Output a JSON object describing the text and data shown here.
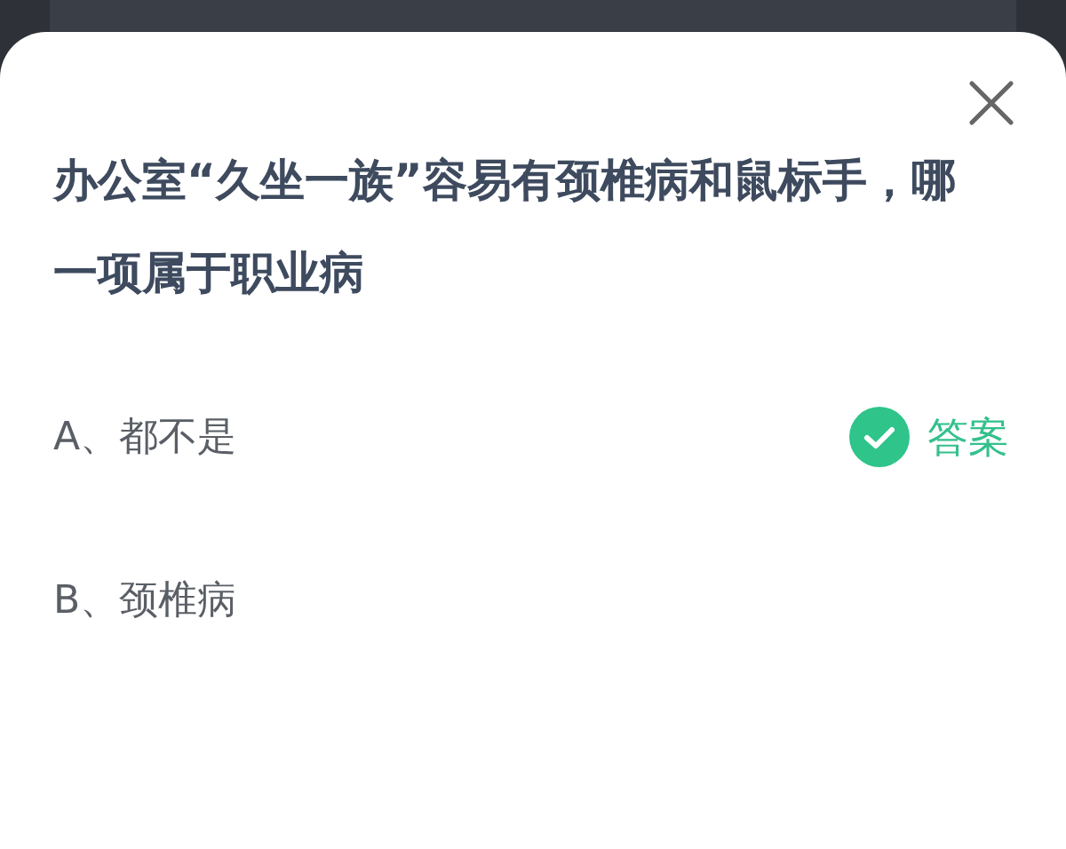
{
  "question": "办公室“久坐一族”容易有颈椎病和鼠标手，哪一项属于职业病",
  "options": [
    {
      "label": "A、都不是",
      "correct": true
    },
    {
      "label": "B、颈椎病",
      "correct": false
    }
  ],
  "answer_label": "答案"
}
